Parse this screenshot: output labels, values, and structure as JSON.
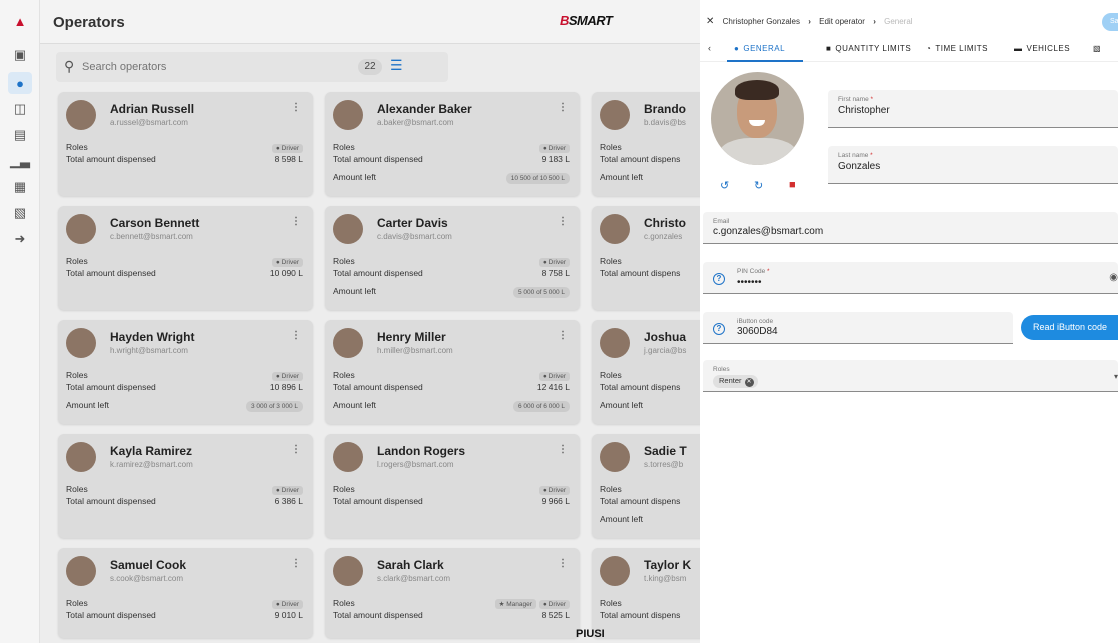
{
  "rail": {
    "icons": [
      "logo-icon",
      "monitor-icon",
      "operator-icon",
      "fuel-pump-icon",
      "tank-icon",
      "chart-icon",
      "dispenser-icon",
      "map-icon",
      "export-icon"
    ]
  },
  "header": {
    "title": "Operators",
    "brand_prefix": "B",
    "brand_suffix": "SMART"
  },
  "search": {
    "placeholder": "Search operators",
    "count": "22"
  },
  "cards": [
    {
      "name": "Adrian Russell",
      "email": "a.russel@bsmart.com",
      "roles_label": "Roles",
      "role": "Driver",
      "dispensed_label": "Total amount dispensed",
      "dispensed": "8 598 L"
    },
    {
      "name": "Alexander Baker",
      "email": "a.baker@bsmart.com",
      "roles_label": "Roles",
      "role": "Driver",
      "dispensed_label": "Total amount dispensed",
      "dispensed": "9 183 L",
      "left_label": "Amount left",
      "left": "10 500 of 10 500 L"
    },
    {
      "name": "Brando",
      "email": "b.davis@bs",
      "roles_label": "Roles",
      "dispensed_label": "Total amount dispens",
      "left_label": "Amount left"
    },
    {
      "name": "Carson Bennett",
      "email": "c.bennett@bsmart.com",
      "roles_label": "Roles",
      "role": "Driver",
      "dispensed_label": "Total amount dispensed",
      "dispensed": "10 090 L"
    },
    {
      "name": "Carter Davis",
      "email": "c.davis@bsmart.com",
      "roles_label": "Roles",
      "role": "Driver",
      "dispensed_label": "Total amount dispensed",
      "dispensed": "8 758 L",
      "left_label": "Amount left",
      "left": "5 000 of 5 000 L"
    },
    {
      "name": "Christo",
      "email": "c.gonzales",
      "roles_label": "Roles",
      "dispensed_label": "Total amount dispens"
    },
    {
      "name": "Hayden Wright",
      "email": "h.wright@bsmart.com",
      "roles_label": "Roles",
      "role": "Driver",
      "dispensed_label": "Total amount dispensed",
      "dispensed": "10 896 L",
      "left_label": "Amount left",
      "left": "3 000 of 3 000 L"
    },
    {
      "name": "Henry Miller",
      "email": "h.miller@bsmart.com",
      "roles_label": "Roles",
      "role": "Driver",
      "dispensed_label": "Total amount dispensed",
      "dispensed": "12 416 L",
      "left_label": "Amount left",
      "left": "6 000 of 6 000 L"
    },
    {
      "name": "Joshua",
      "email": "j.garcia@bs",
      "roles_label": "Roles",
      "dispensed_label": "Total amount dispens",
      "left_label": "Amount left"
    },
    {
      "name": "Kayla Ramirez",
      "email": "k.ramirez@bsmart.com",
      "roles_label": "Roles",
      "role": "Driver",
      "dispensed_label": "Total amount dispensed",
      "dispensed": "6 386 L"
    },
    {
      "name": "Landon Rogers",
      "email": "l.rogers@bsmart.com",
      "roles_label": "Roles",
      "role": "Driver",
      "dispensed_label": "Total amount dispensed",
      "dispensed": "9 966 L"
    },
    {
      "name": "Sadie T",
      "email": "s.torres@b",
      "roles_label": "Roles",
      "dispensed_label": "Total amount dispens",
      "left_label": "Amount left"
    },
    {
      "name": "Samuel Cook",
      "email": "s.cook@bsmart.com",
      "roles_label": "Roles",
      "role": "Driver",
      "dispensed_label": "Total amount dispensed",
      "dispensed": "9 010 L"
    },
    {
      "name": "Sarah Clark",
      "email": "s.clark@bsmart.com",
      "roles_label": "Roles",
      "role": "Driver",
      "role2": "Manager",
      "dispensed_label": "Total amount dispensed",
      "dispensed": "8 525 L"
    },
    {
      "name": "Taylor K",
      "email": "t.king@bsm",
      "roles_label": "Roles",
      "dispensed_label": "Total amount dispens"
    }
  ],
  "footer": {
    "logo": "PIUSI"
  },
  "panel": {
    "breadcrumb": {
      "close": "✕",
      "crumb1": "Christopher Gonzales",
      "crumb2": "Edit operator",
      "crumb3": "General"
    },
    "save_label": "Sa",
    "tabs": [
      "GENERAL",
      "QUANTITY LIMITS",
      "TIME LIMITS",
      "VEHICLES"
    ],
    "first_name": {
      "label": "First name",
      "value": "Christopher"
    },
    "last_name": {
      "label": "Last name",
      "value": "Gonzales"
    },
    "email": {
      "label": "Email",
      "value": "c.gonzales@bsmart.com"
    },
    "pin": {
      "label": "PIN Code",
      "value": "•••••••"
    },
    "ibutton": {
      "label": "iButton code",
      "value": "3060D84"
    },
    "read_button": "Read iButton code",
    "roles": {
      "label": "Roles",
      "chip": "Renter"
    }
  },
  "colors": {
    "accent": "#1e73c8",
    "danger": "#d32f2f",
    "brand_red": "#c8102e"
  }
}
